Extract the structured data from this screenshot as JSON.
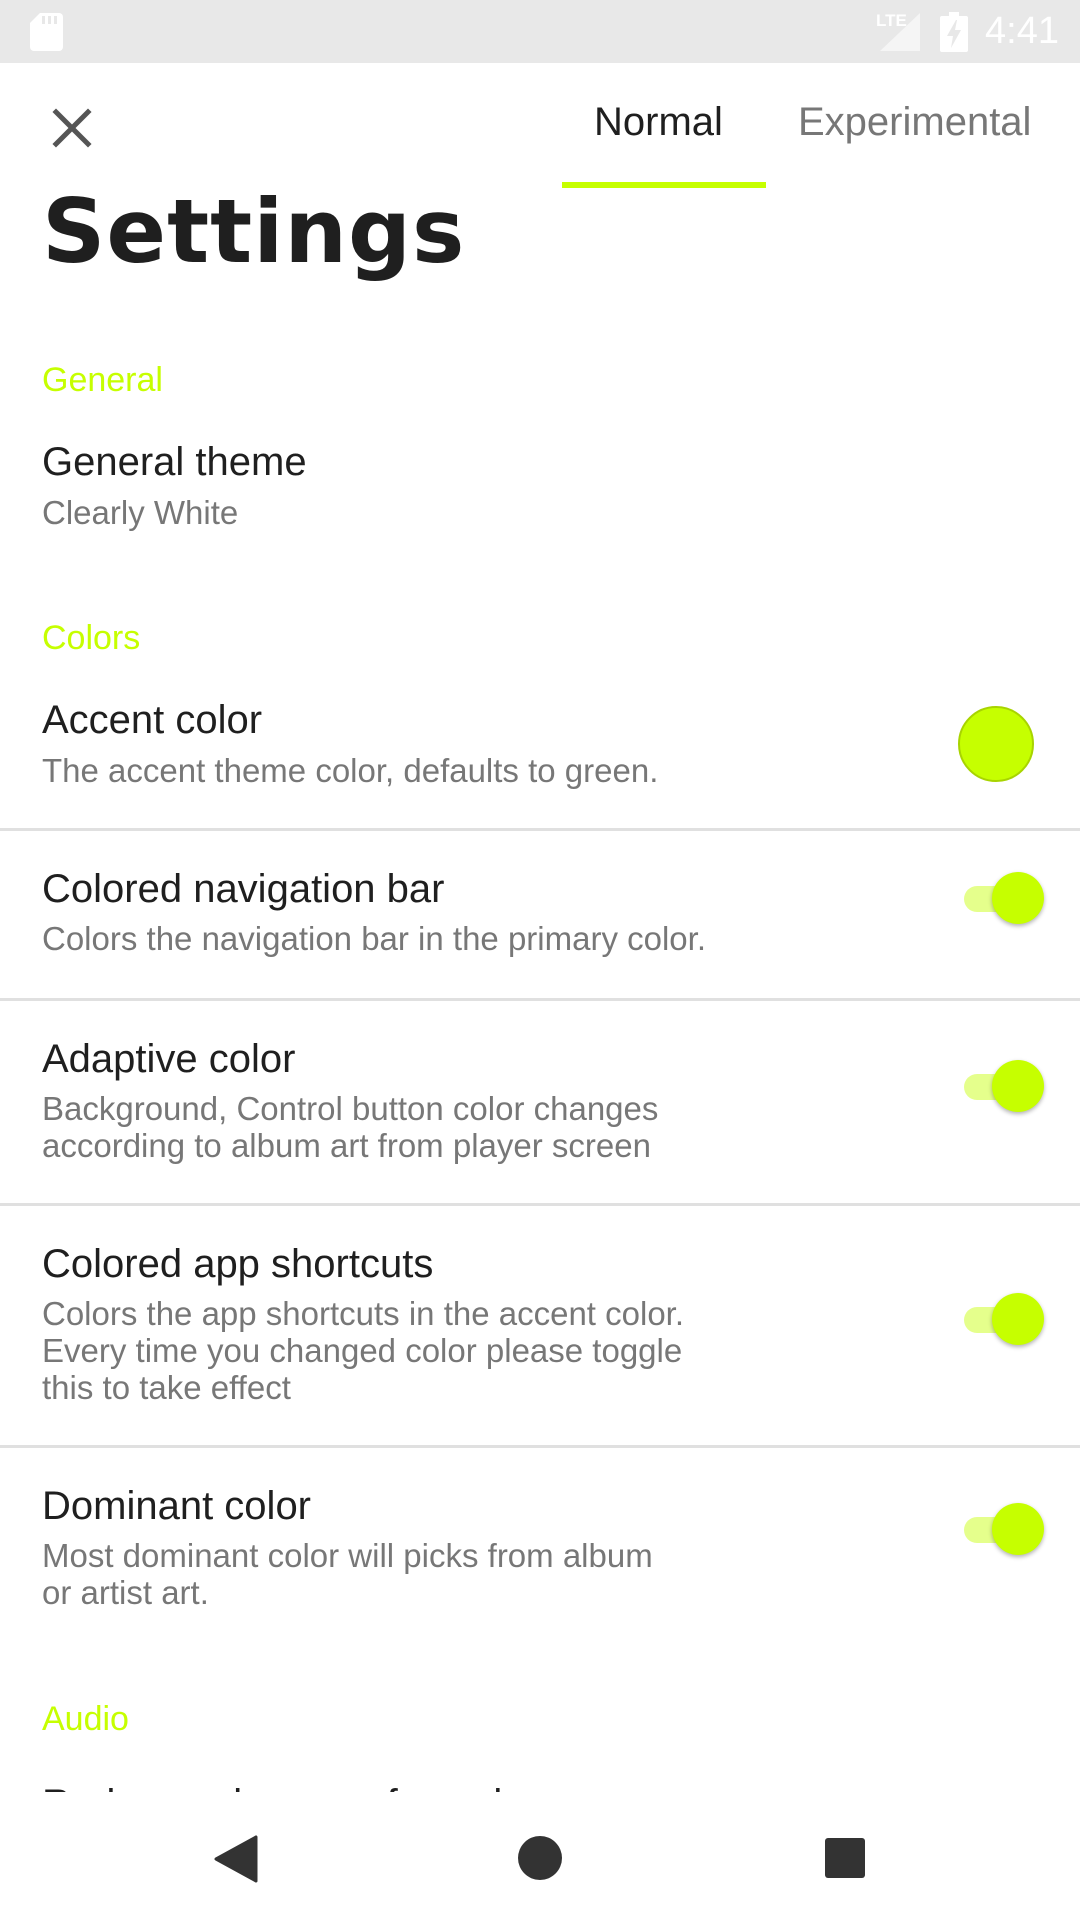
{
  "colors": {
    "accent": "#c6ff00",
    "text_primary": "#1f1f1f",
    "text_secondary": "#777777",
    "status_bar_bg": "#e8e8e8"
  },
  "status_bar": {
    "network_label": "LTE",
    "time": "4:41",
    "icons": [
      "sd-card-icon",
      "signal-icon",
      "battery-charging-icon"
    ]
  },
  "header": {
    "close_icon": "close-icon",
    "tabs": [
      {
        "label": "Normal",
        "selected": true
      },
      {
        "label": "Experimental",
        "selected": false
      }
    ],
    "title": "Settings"
  },
  "sections": {
    "general": {
      "header": "General",
      "theme": {
        "title": "General theme",
        "summary": "Clearly White"
      }
    },
    "colors": {
      "header": "Colors",
      "accent": {
        "title": "Accent color",
        "summary": "The accent theme color, defaults to green."
      },
      "nav_bar": {
        "title": "Colored navigation bar",
        "summary": "Colors the navigation bar in the primary color.",
        "enabled": true
      },
      "adaptive": {
        "title": "Adaptive color",
        "summary_line1": "Background, Control button color changes",
        "summary_line2": "according to album art from player screen",
        "enabled": true
      },
      "shortcuts": {
        "title": "Colored app shortcuts",
        "summary_line1": "Colors the app shortcuts in the accent color.",
        "summary_line2": "Every time you changed color please toggle",
        "summary_line3": "this to take effect",
        "enabled": true
      },
      "dominant": {
        "title": "Dominant color",
        "summary_line1": "Most dominant color will picks from album",
        "summary_line2": "or artist art.",
        "enabled": true
      }
    },
    "audio": {
      "header": "Audio",
      "next_item_partial": "Reduce volume on focus loss"
    }
  },
  "nav_bar": {
    "icons": [
      "back-icon",
      "home-icon",
      "recents-icon"
    ]
  }
}
